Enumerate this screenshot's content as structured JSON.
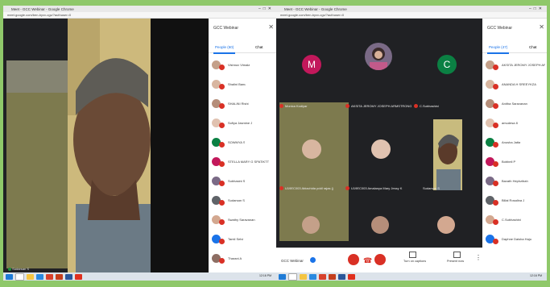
{
  "left": {
    "title": "Meet - GCC Webinar - Google Chrome",
    "url": "meet.google.com/ben-byxv-cgz/?authuser=0",
    "panel_title": "GCC Webinar",
    "tab_people": "People (60)",
    "tab_chat": "Chat",
    "self_name": "Sudarsan S",
    "people": [
      "Vishnuv Vimala",
      "Shalini Banu",
      "SHALINI Rishi",
      "Sofiya Jasmine J",
      "SOWMYA S",
      "STELLA MARY G SPATIKTT",
      "Subhasini S",
      "Sudarsan S",
      "Swathy Saravanan",
      "Tamil Selvi",
      "Tharani A"
    ],
    "time": "12:16 PM"
  },
  "right": {
    "title": "Meet - GCC Webinar - Google Chrome",
    "url": "meet.google.com/ben-byxv-cgz/?authuser=0",
    "panel_title": "GCC Webinar",
    "tab_people": "People (47)",
    "tab_chat": "Chat",
    "tiles": [
      "Monica Kodiyar",
      "AKSITA JEROMY JOSEPH ARMSTRONG",
      "C.Subhashini",
      "U19EC003 Abiachida pddl rajas (j",
      "U19EC003 Amalanya Mary Jessy K",
      "Sudarsan S"
    ],
    "meeting_name": "GCC Webinar",
    "ctrl_captions": "Turn on captions",
    "ctrl_present": "Present now",
    "people": [
      "AKSITA JEROMY JOSEPH ARMSTRONG",
      "ANANDA H SREEYKZA",
      "Anitha Saravanan",
      "amudesa 8",
      "Anusha Jatta",
      "Bobbeli P",
      "Bavath Hephzibah",
      "Billal Rosalina J",
      "C.Subhashini",
      "Daphne Daisha Haju"
    ],
    "time": "12:16 PM"
  },
  "colors": {
    "accent": "#1a73e8",
    "end_call": "#d93025",
    "taskbar": "#dce3ea"
  }
}
